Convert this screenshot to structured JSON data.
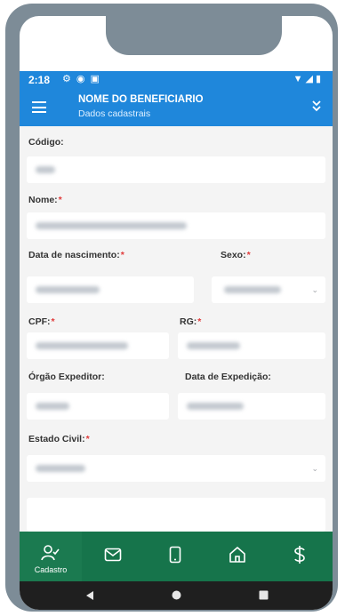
{
  "status": {
    "time": "2:18"
  },
  "header": {
    "title": "NOME DO BENEFICIARIO",
    "subtitle": "Dados cadastrais"
  },
  "form": {
    "codigo_label": "Código:",
    "nome_label": "Nome:",
    "nascimento_label": "Data de nascimento:",
    "sexo_label": "Sexo:",
    "cpf_label": "CPF:",
    "rg_label": "RG:",
    "orgao_label": "Órgão Expeditor:",
    "expedicao_label": "Data de Expedição:",
    "estado_civil_label": "Estado Civil:",
    "required_mark": "*"
  },
  "bottom_nav": {
    "items": [
      {
        "label": "Cadastro",
        "icon": "person-check-icon"
      },
      {
        "label": "",
        "icon": "mail-icon"
      },
      {
        "label": "",
        "icon": "phone-icon"
      },
      {
        "label": "",
        "icon": "home-icon"
      },
      {
        "label": "",
        "icon": "dollar-icon"
      }
    ]
  },
  "colors": {
    "appbar": "#1f87db",
    "bottom_nav": "#16744b",
    "required": "#e03a3a",
    "frame": "#7d8c97"
  }
}
